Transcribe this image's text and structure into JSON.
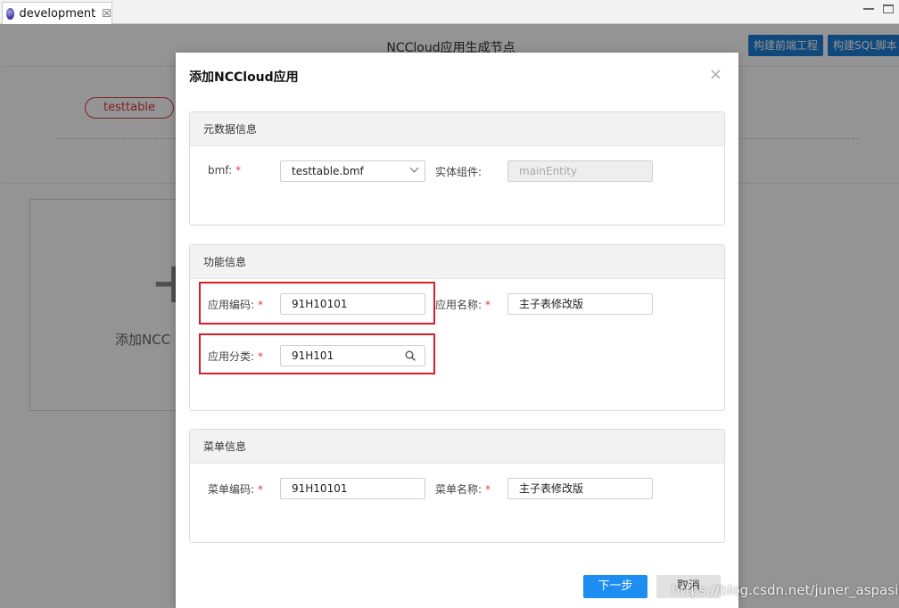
{
  "window": {
    "tab_label": "development",
    "tab_close": "☒"
  },
  "page": {
    "title": "NCCloud应用生成节点",
    "buttons": [
      "构建前端工程",
      "构建SQL脚本"
    ],
    "table_pill": "testtable",
    "add_card_plus": "+",
    "add_card_label": "添加NCC"
  },
  "modal": {
    "title": "添加NCCloud应用",
    "close": "×",
    "sections": {
      "metadata": {
        "heading": "元数据信息",
        "bmf_label": "bmf:",
        "bmf_value": "testtable.bmf",
        "entity_label": "实体组件:",
        "entity_value": "mainEntity"
      },
      "function": {
        "heading": "功能信息",
        "app_code_label": "应用编码:",
        "app_code_value": "91H10101",
        "app_name_label": "应用名称:",
        "app_name_value": "主子表修改版",
        "app_category_label": "应用分类:",
        "app_category_value": "91H101"
      },
      "menu": {
        "heading": "菜单信息",
        "menu_code_label": "菜单编码:",
        "menu_code_value": "91H10101",
        "menu_name_label": "菜单名称:",
        "menu_name_value": "主子表修改版"
      }
    },
    "required_mark": "*",
    "next_button": "下一步",
    "cancel_button": "取消"
  },
  "watermark": "https://blog.csdn.net/juner_aspasia",
  "colors": {
    "primary": "#1e8df2",
    "required": "#e23c3c",
    "highlight": "#d81e2a",
    "toolbar_button": "#1e7fd8"
  },
  "icons": [
    "app-icon",
    "close-icon",
    "chevron-down-icon",
    "search-icon"
  ]
}
